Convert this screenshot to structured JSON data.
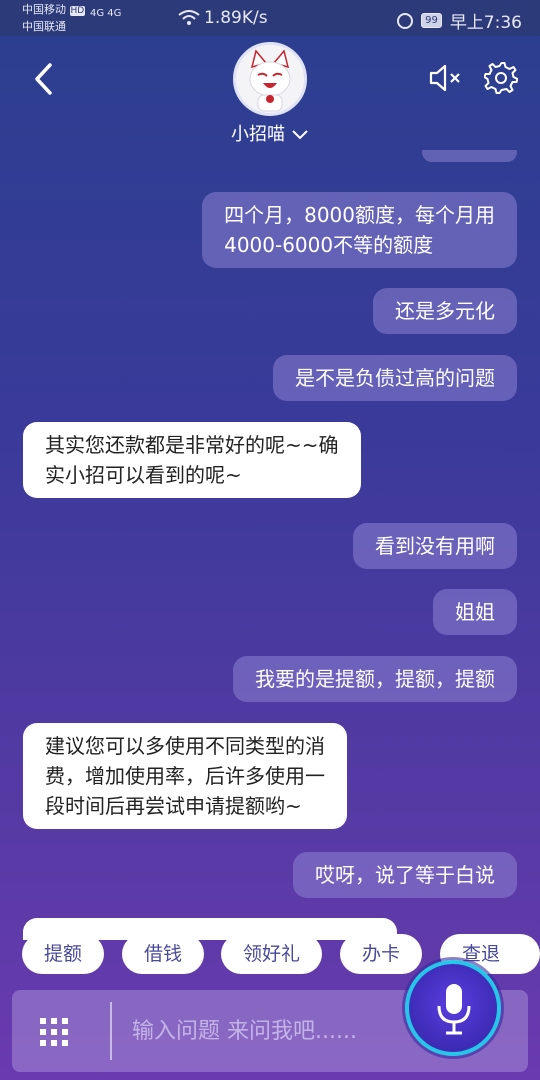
{
  "status_bar": {
    "carrier_1": "中国移动",
    "carrier_1_badge": "HD",
    "carrier_2": "中国联通",
    "network": "4G 4G",
    "speed": "1.89K/s",
    "battery": "99",
    "time": "早上7:36"
  },
  "header": {
    "title": "小招喵"
  },
  "messages": [
    {
      "role": "user",
      "text": "四个月，8000额度，每个月用\n4000-6000不等的额度"
    },
    {
      "role": "user",
      "text": "还是多元化"
    },
    {
      "role": "user",
      "text": "是不是负债过高的问题"
    },
    {
      "role": "bot",
      "text": "其实您还款都是非常好的呢~~确\n实小招可以看到的呢~"
    },
    {
      "role": "user",
      "text": "看到没有用啊"
    },
    {
      "role": "user",
      "text": "姐姐"
    },
    {
      "role": "user",
      "text": "我要的是提额，提额，提额"
    },
    {
      "role": "bot",
      "text": "建议您可以多使用不同类型的消\n费，增加使用率，后许多使用一\n段时间后再尝试申请提额哟~"
    },
    {
      "role": "user",
      "text": "哎呀，说了等于白说"
    }
  ],
  "quick_replies": [
    "提额",
    "借钱",
    "领好礼",
    "办卡",
    "查退款"
  ],
  "input": {
    "value": "",
    "placeholder": "输入问题 来问我吧......"
  },
  "colors": {
    "accent_ring": "#26c6e8",
    "mic_fill": "#4a34d0"
  }
}
